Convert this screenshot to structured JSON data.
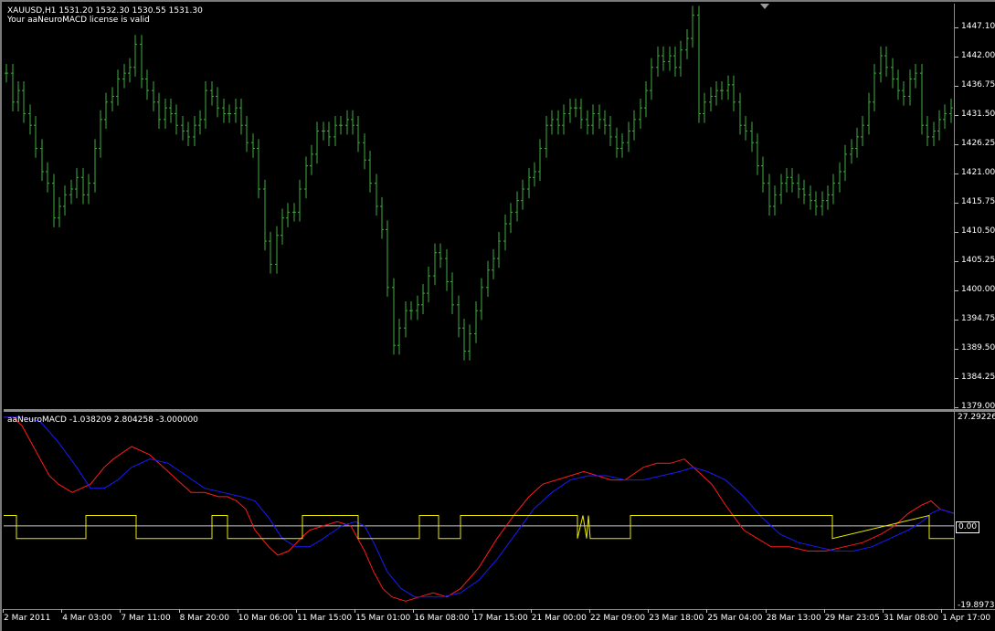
{
  "window": {
    "symbol_line": "XAUUSD,H1  1531.20 1532.30 1530.55 1531.30",
    "license_line": "Your aaNeuroMACD license is valid"
  },
  "indicator": {
    "label": "aaNeuroMACD -1.038209 2.804258 -3.000000",
    "top_value": "27.29226",
    "zero_value": "0.00",
    "bottom_value": "-19.8973"
  },
  "price_axis": [
    "1447.10",
    "1442.00",
    "1436.75",
    "1431.50",
    "1426.25",
    "1421.00",
    "1415.75",
    "1410.50",
    "1405.25",
    "1400.00",
    "1394.75",
    "1389.50",
    "1384.25",
    "1379.00"
  ],
  "time_axis": [
    "2 Mar 2011",
    "4 Mar 03:00",
    "7 Mar 11:00",
    "8 Mar 20:00",
    "10 Mar 06:00",
    "11 Mar 15:00",
    "15 Mar 01:00",
    "16 Mar 08:00",
    "17 Mar 15:00",
    "21 Mar 00:00",
    "22 Mar 09:00",
    "23 Mar 18:00",
    "25 Mar 04:00",
    "28 Mar 13:00",
    "29 Mar 23:05",
    "31 Mar 08:00",
    "1 Apr 17:00"
  ],
  "colors": {
    "bars": "#3fae3f",
    "neuro_red": "#ff1a1a",
    "neuro_blue": "#1a1aff",
    "neuro_yellow": "#e8e800",
    "zero_line": "#c8c8c8"
  },
  "chart_data": [
    {
      "type": "bar",
      "title": "XAUUSD,H1",
      "ylim": [
        1379.0,
        1449.0
      ],
      "close": [
        1437,
        1432,
        1434,
        1430,
        1428,
        1424,
        1420,
        1418,
        1412,
        1414,
        1416,
        1417,
        1419,
        1416,
        1418,
        1424,
        1429,
        1432,
        1433,
        1436,
        1437,
        1438,
        1442,
        1436,
        1434,
        1432,
        1429,
        1431,
        1430,
        1428,
        1427,
        1426,
        1428,
        1429,
        1434,
        1433,
        1431,
        1430,
        1430,
        1431,
        1428,
        1425,
        1424,
        1417,
        1408,
        1404,
        1409,
        1412,
        1413,
        1413,
        1417,
        1421,
        1423,
        1427,
        1427,
        1426,
        1428,
        1428,
        1429,
        1428,
        1425,
        1422,
        1418,
        1414,
        1410,
        1400,
        1390,
        1393,
        1396,
        1396,
        1397,
        1399,
        1402,
        1406,
        1405,
        1401,
        1397,
        1393,
        1389,
        1392,
        1396,
        1400,
        1403,
        1405,
        1408,
        1411,
        1413,
        1415,
        1417,
        1419,
        1420,
        1424,
        1428,
        1429,
        1428,
        1430,
        1431,
        1431,
        1429,
        1428,
        1430,
        1429,
        1428,
        1426,
        1424,
        1425,
        1427,
        1429,
        1431,
        1434,
        1438,
        1440,
        1439,
        1440,
        1438,
        1441,
        1443,
        1447,
        1430,
        1432,
        1433,
        1434,
        1434,
        1435,
        1432,
        1428,
        1427,
        1425,
        1421,
        1418,
        1414,
        1416,
        1418,
        1419,
        1418,
        1417,
        1416,
        1415,
        1414,
        1415,
        1416,
        1418,
        1420,
        1423,
        1424,
        1426,
        1428,
        1432,
        1437,
        1440,
        1438,
        1436,
        1434,
        1433,
        1436,
        1437,
        1428,
        1426,
        1427,
        1429,
        1430,
        1431
      ]
    },
    {
      "type": "line",
      "title": "aaNeuroMACD",
      "ylim": [
        -19.8973,
        27.29226
      ],
      "series": [
        {
          "name": "red",
          "x": [
            0,
            10,
            20,
            35,
            50,
            60,
            75,
            95,
            110,
            120,
            140,
            160,
            185,
            205,
            220,
            235,
            245,
            255,
            265,
            275,
            290,
            300,
            312,
            325,
            335,
            350,
            365,
            380,
            395,
            405,
            415,
            425,
            440,
            455,
            470,
            485,
            500,
            520,
            540,
            560,
            575,
            590,
            605,
            620,
            635,
            650,
            665,
            680,
            700,
            715,
            730,
            745,
            760,
            775,
            790,
            800,
            810,
            825,
            840,
            860,
            880,
            900,
            920,
            940,
            960,
            975,
            990,
            1005,
            1015,
            1025,
            1040
          ],
          "values": [
            26,
            26,
            24,
            18,
            12,
            10,
            8,
            10,
            14,
            16,
            19,
            17,
            12,
            8,
            8,
            7,
            7,
            6,
            4,
            -1,
            -5,
            -7,
            -6,
            -3,
            -1,
            0,
            1,
            0,
            -6,
            -11,
            -15,
            -17,
            -18,
            -17,
            -16,
            -17,
            -15,
            -10,
            -3,
            3,
            7,
            10,
            11,
            12,
            13,
            12,
            11,
            11,
            14,
            15,
            15,
            16,
            13,
            10,
            5,
            2,
            -1,
            -3,
            -5,
            -5,
            -6,
            -6,
            -5,
            -4,
            -2,
            0,
            3,
            5,
            6,
            4,
            3
          ]
        },
        {
          "name": "blue",
          "x": [
            0,
            20,
            40,
            60,
            80,
            95,
            110,
            125,
            140,
            160,
            180,
            200,
            220,
            240,
            260,
            275,
            290,
            305,
            320,
            335,
            350,
            370,
            385,
            395,
            405,
            420,
            435,
            450,
            465,
            480,
            500,
            520,
            540,
            560,
            580,
            600,
            620,
            640,
            660,
            680,
            700,
            720,
            740,
            755,
            770,
            790,
            810,
            830,
            850,
            870,
            890,
            910,
            930,
            950,
            970,
            990,
            1005,
            1015,
            1025,
            1040
          ],
          "values": [
            26,
            26,
            25,
            20,
            14,
            9,
            9,
            11,
            14,
            16,
            15,
            12,
            9,
            8,
            7,
            6,
            2,
            -3,
            -5,
            -5,
            -3,
            0,
            1,
            0,
            -4,
            -11,
            -15,
            -17,
            -17,
            -17,
            -16,
            -13,
            -8,
            -2,
            4,
            8,
            11,
            12,
            12,
            11,
            11,
            12,
            13,
            14,
            13,
            11,
            7,
            2,
            -2,
            -4,
            -5,
            -6,
            -6,
            -5,
            -3,
            -1,
            1,
            3,
            4,
            3
          ]
        },
        {
          "name": "yellow",
          "x": [
            0,
            14,
            14,
            90,
            90,
            145,
            145,
            228,
            228,
            245,
            245,
            327,
            327,
            388,
            388,
            455,
            455,
            476,
            476,
            500,
            500,
            628,
            628,
            634,
            638,
            640,
            642,
            645,
            686,
            686,
            907,
            907,
            1013,
            1013,
            1040
          ],
          "values": [
            2.5,
            2.5,
            -3,
            -3,
            2.5,
            2.5,
            -3,
            -3,
            2.5,
            2.5,
            -3,
            -3,
            2.5,
            2.5,
            -3,
            -3,
            2.5,
            2.5,
            -3,
            -3,
            2.5,
            2.5,
            -3,
            2.5,
            -3,
            2.5,
            -3,
            -3,
            -3,
            2.5,
            2.5,
            -3,
            2.5,
            -3,
            -3
          ]
        }
      ]
    }
  ]
}
